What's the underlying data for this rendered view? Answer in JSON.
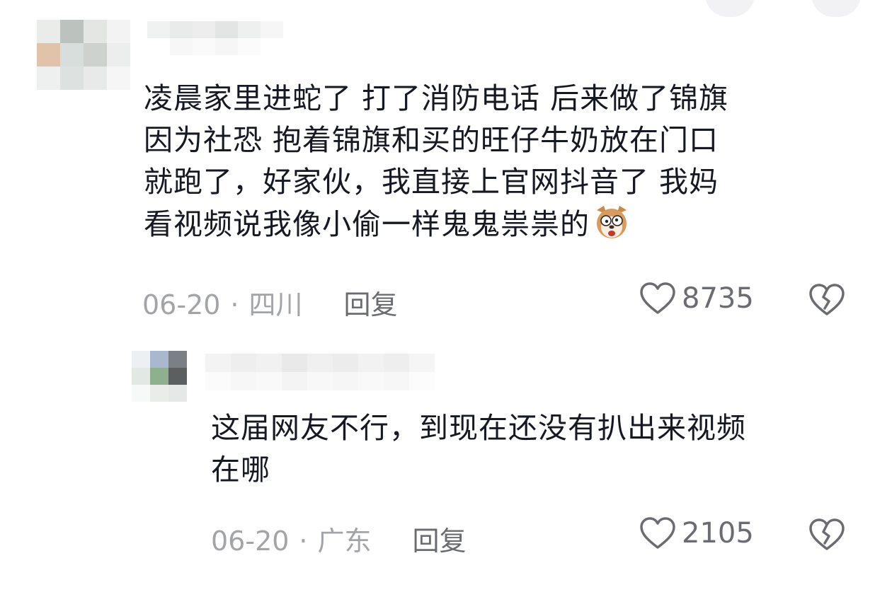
{
  "comments": [
    {
      "text": "凌晨家里进蛇了 打了消防电话 后来做了锦旗\n因为社恐 抱着锦旗和买的旺仔牛奶放在门口\n就跑了，好家伙，我直接上官网抖音了 我妈\n看视频说我像小偷一样鬼鬼祟祟的",
      "emoji_icon": "dog-face-emoji",
      "date": "06-20",
      "location": "四川",
      "reply_label": "回复",
      "likes": "8735"
    },
    {
      "text": "这届网友不行，到现在还没有扒出来视频\n在哪",
      "date": "06-20",
      "location": "广东",
      "reply_label": "回复",
      "likes": "2105"
    }
  ],
  "separator": "·",
  "icons": {
    "like": "heart-outline-icon",
    "dislike": "broken-heart-icon"
  },
  "colors": {
    "text": "#161823",
    "meta": "#a3a4a8",
    "action": "#6b6c72"
  }
}
